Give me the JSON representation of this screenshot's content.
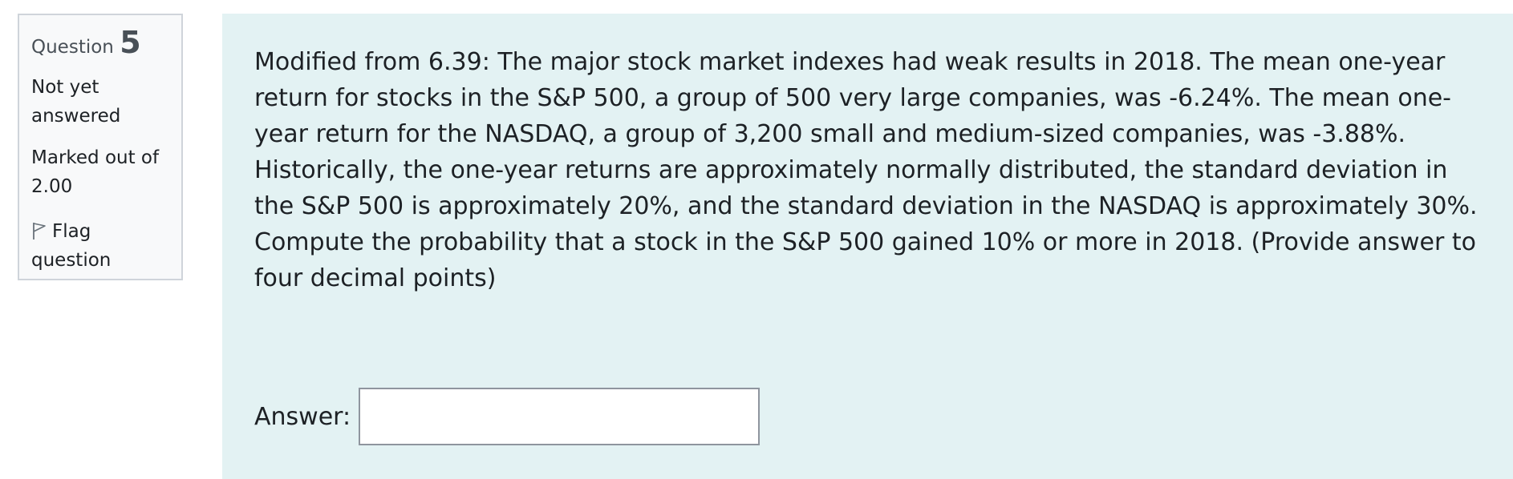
{
  "question_info": {
    "label": "Question",
    "number": "5",
    "state_line1": "Not yet",
    "state_line2": "answered",
    "grade_line1": "Marked out of",
    "grade_line2": "2.00",
    "flag_line1": "Flag",
    "flag_line2": "question",
    "flag_icon": "flag-outline-icon"
  },
  "question": {
    "text": "Modified from 6.39: The major stock market indexes had weak results in 2018.  The mean one-year return for stocks in the S&P 500, a group of 500 very large companies, was -6.24%.  The mean one-year return for the NASDAQ, a group of 3,200 small and medium-sized companies, was -3.88%.  Historically, the one-year returns are approximately normally distributed, the standard deviation in the S&P 500 is approximately 20%, and the standard deviation in the NASDAQ is approximately 30%.  Compute the probability that a stock in the S&P 500 gained 10% or more in 2018.  (Provide answer to four decimal points)",
    "answer_label": "Answer:",
    "answer_value": ""
  }
}
